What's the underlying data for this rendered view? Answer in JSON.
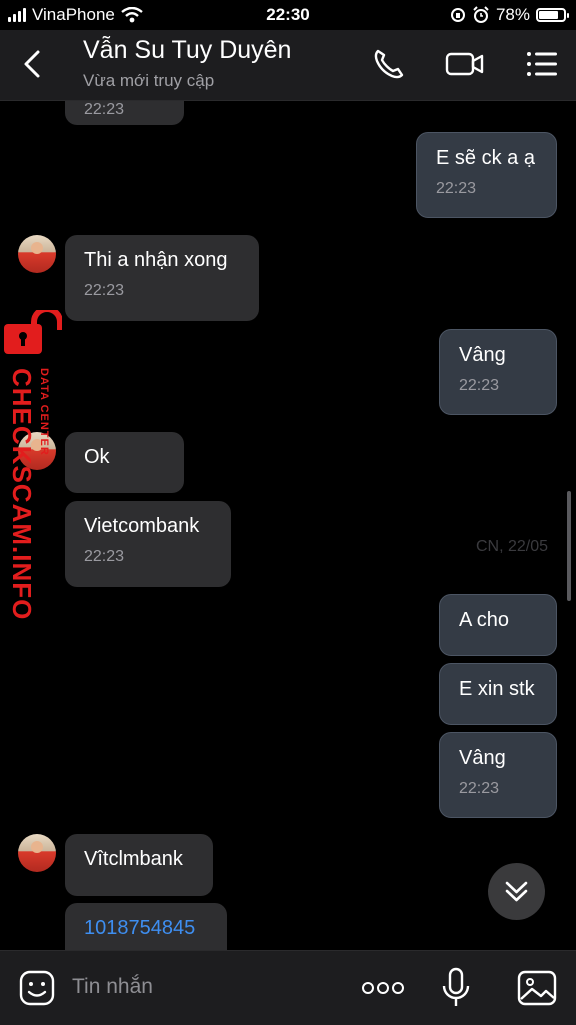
{
  "status_bar": {
    "carrier": "VinaPhone",
    "time": "22:30",
    "battery": "78%",
    "battery_level": 0.78
  },
  "header": {
    "contact_name": "Vẫn Su Tuy Duyên",
    "status": "Vừa mới truy cập"
  },
  "messages": [
    {
      "dir": "in",
      "text": "",
      "time": "22:23"
    },
    {
      "dir": "out",
      "text": "E sẽ ck a ạ",
      "time": "22:23"
    },
    {
      "dir": "in",
      "text": "Thi a nhận xong",
      "time": "22:23"
    },
    {
      "dir": "out",
      "text": "Vâng",
      "time": "22:23"
    },
    {
      "dir": "in",
      "text": "Ok",
      "time": ""
    },
    {
      "dir": "in",
      "text": "Vietcombank",
      "time": "22:23"
    },
    {
      "dir": "out",
      "text": "A cho",
      "time": ""
    },
    {
      "dir": "out",
      "text": "E xin stk",
      "time": ""
    },
    {
      "dir": "out",
      "text": "Vâng",
      "time": "22:23"
    },
    {
      "dir": "in",
      "text": "Vîtclmbank",
      "time": ""
    },
    {
      "dir": "in",
      "text": "1018754845",
      "time": ""
    }
  ],
  "date_separator": "CN, 22/05",
  "watermark": {
    "brand": "CHECKSCAM.INFO",
    "sub": "DATA CENTER"
  },
  "composer": {
    "placeholder": "Tin nhắn"
  },
  "colors": {
    "background": "#000000",
    "bubble_in": "#2e2e30",
    "bubble_out": "#343b45",
    "link": "#3e8ef0",
    "watermark": "#e21d1d"
  }
}
